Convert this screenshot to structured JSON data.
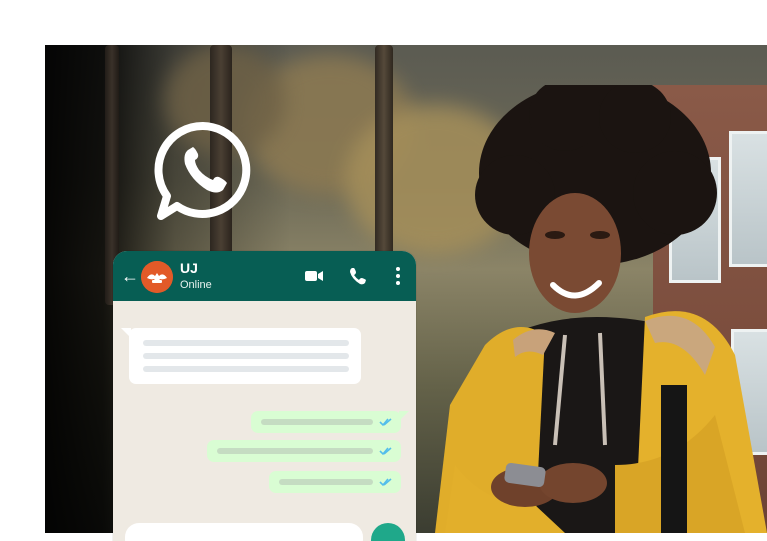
{
  "chat": {
    "contact_name": "UJ",
    "status": "Online"
  },
  "icons": {
    "logo": "whatsapp-logo-icon",
    "back": "arrow-left-icon",
    "video": "video-camera-icon",
    "call": "phone-icon",
    "menu": "more-vertical-icon",
    "ticks": "double-check-icon"
  },
  "colors": {
    "header": "#075e54",
    "chat_background": "#efeae2",
    "outgoing_bubble": "#d9fdd3",
    "incoming_bubble": "#ffffff",
    "read_ticks": "#53bdeb",
    "avatar": "#e25a28",
    "fab": "#1fa88a"
  }
}
